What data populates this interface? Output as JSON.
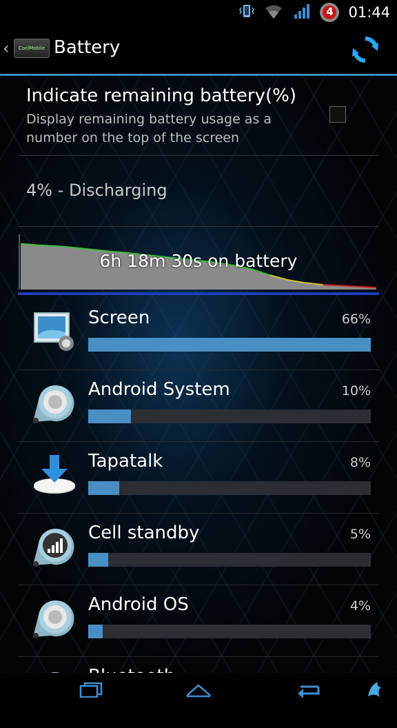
{
  "status_bar": {
    "time": "01:44",
    "notification_count": "4"
  },
  "action_bar": {
    "title": "Battery",
    "logo_text": "CoolMobile"
  },
  "preference": {
    "title": "Indicate remaining battery(%)",
    "summary": "Display remaining battery usage as a number on the top of the screen",
    "checked": false
  },
  "battery_status": "4% - Discharging",
  "graph": {
    "label": "6h 18m 30s on battery",
    "level_series": [
      95,
      92,
      90,
      87,
      83,
      79,
      76,
      72,
      68,
      64,
      60,
      56,
      50,
      42,
      30,
      20,
      14,
      10,
      8,
      6,
      4
    ]
  },
  "usage": [
    {
      "name": "Screen",
      "percent_label": "66%",
      "fraction": 1.0,
      "icon": "screen-settings-icon"
    },
    {
      "name": "Android System",
      "percent_label": "10%",
      "fraction": 0.15,
      "icon": "android-system-icon"
    },
    {
      "name": "Tapatalk",
      "percent_label": "8%",
      "fraction": 0.11,
      "icon": "tapatalk-download-icon"
    },
    {
      "name": "Cell standby",
      "percent_label": "5%",
      "fraction": 0.07,
      "icon": "cell-signal-icon"
    },
    {
      "name": "Android OS",
      "percent_label": "4%",
      "fraction": 0.05,
      "icon": "android-os-icon"
    },
    {
      "name": "Bluetooth",
      "percent_label": "",
      "fraction": 0,
      "icon": "bluetooth-icon"
    }
  ],
  "nav": {
    "recent_icon": "recent-apps-icon",
    "home_icon": "home-icon",
    "back_icon": "back-icon"
  }
}
